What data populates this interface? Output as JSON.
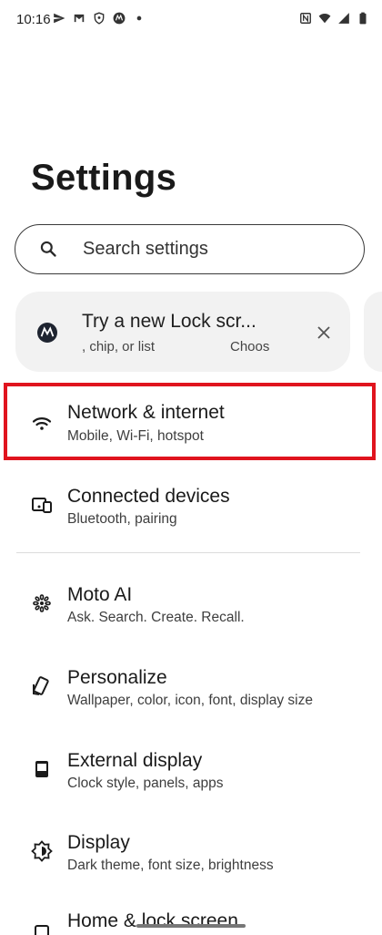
{
  "status_bar": {
    "time": "10:16",
    "left_icons": [
      "send-icon",
      "gmail-icon",
      "shield-icon",
      "motorola-icon",
      "dot-icon"
    ],
    "right_icons": [
      "nfc-icon",
      "wifi-icon",
      "signal-icon",
      "battery-icon"
    ]
  },
  "page": {
    "title": "Settings"
  },
  "search": {
    "placeholder": "Search settings"
  },
  "suggestion": {
    "title": "Try a new Lock scr...",
    "subtitle_left": ", chip, or list",
    "subtitle_right": "Choos"
  },
  "settings": [
    {
      "title": "Network & internet",
      "subtitle": "Mobile, Wi-Fi, hotspot",
      "icon": "wifi-icon"
    },
    {
      "title": "Connected devices",
      "subtitle": "Bluetooth, pairing",
      "icon": "devices-icon"
    },
    {
      "title": "Moto AI",
      "subtitle": "Ask. Search. Create. Recall.",
      "icon": "moto-ai-icon"
    },
    {
      "title": "Personalize",
      "subtitle": "Wallpaper, color, icon, font, display size",
      "icon": "personalize-icon"
    },
    {
      "title": "External display",
      "subtitle": "Clock style, panels, apps",
      "icon": "external-display-icon"
    },
    {
      "title": "Display",
      "subtitle": "Dark theme, font size, brightness",
      "icon": "display-icon"
    },
    {
      "title": "Home & lock screen",
      "subtitle": "",
      "icon": "home-lock-icon"
    }
  ],
  "colors": {
    "highlight": "#e0141e",
    "card_bg": "#f2f2f2"
  }
}
